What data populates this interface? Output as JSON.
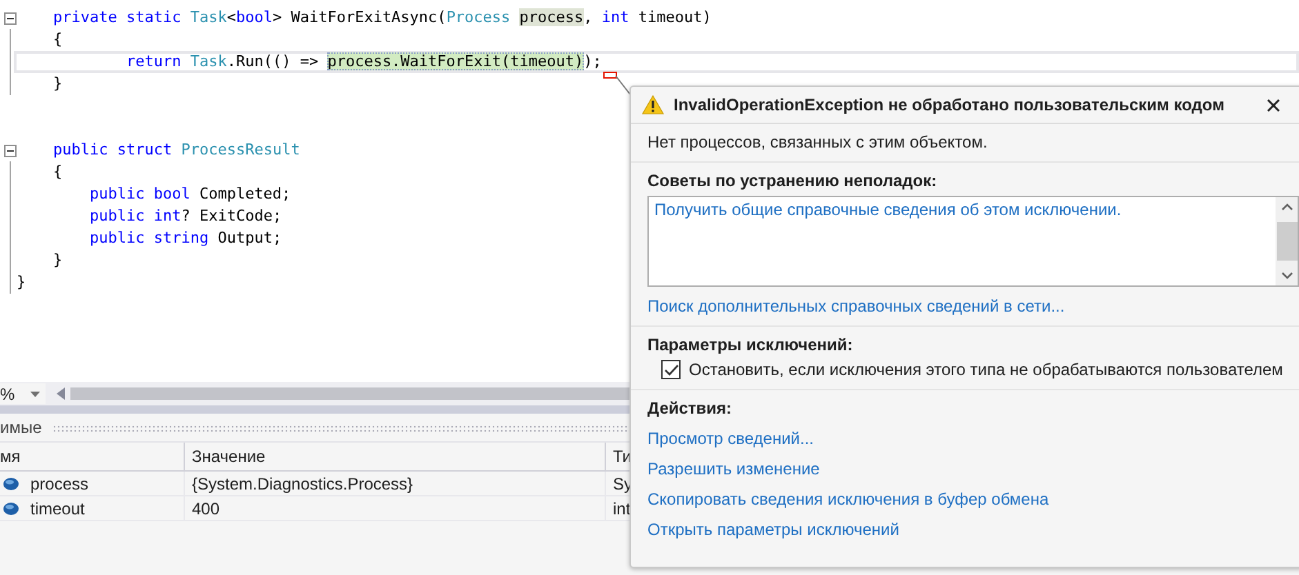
{
  "editor": {
    "lines": [
      {
        "fold": true,
        "current": false,
        "tokens": [
          {
            "text": "    private static ",
            "kind": "kw"
          },
          {
            "text": "Task",
            "kind": "type"
          },
          {
            "text": "<",
            "kind": "plain"
          },
          {
            "text": "bool",
            "kind": "kw"
          },
          {
            "text": "> WaitForExitAsync(",
            "kind": "plain"
          },
          {
            "text": "Process ",
            "kind": "type"
          },
          {
            "text": "process",
            "kind": "ref"
          },
          {
            "text": ", ",
            "kind": "plain"
          },
          {
            "text": "int",
            "kind": "kw"
          },
          {
            "text": " timeout)",
            "kind": "plain"
          }
        ]
      },
      {
        "fold": false,
        "current": false,
        "tokens": [
          {
            "text": "    {",
            "kind": "plain"
          }
        ]
      },
      {
        "fold": false,
        "current": true,
        "tokens": [
          {
            "text": "            return ",
            "kind": "kw"
          },
          {
            "text": "Task",
            "kind": "type"
          },
          {
            "text": ".Run(() => ",
            "kind": "plain"
          },
          {
            "text": "process.WaitForExit(timeout)",
            "kind": "exec"
          },
          {
            "text": ");",
            "kind": "plain"
          }
        ]
      },
      {
        "fold": false,
        "current": false,
        "tokens": [
          {
            "text": "    }",
            "kind": "plain"
          }
        ]
      },
      {
        "fold": false,
        "current": false
      },
      {
        "fold": false,
        "current": false
      },
      {
        "fold": true,
        "current": false,
        "tokens": [
          {
            "text": "    public struct ",
            "kind": "kw"
          },
          {
            "text": "ProcessResult",
            "kind": "type"
          }
        ]
      },
      {
        "fold": false,
        "current": false,
        "tokens": [
          {
            "text": "    {",
            "kind": "plain"
          }
        ]
      },
      {
        "fold": false,
        "current": false,
        "tokens": [
          {
            "text": "        public bool ",
            "kind": "kw"
          },
          {
            "text": "Completed;",
            "kind": "plain"
          }
        ]
      },
      {
        "fold": false,
        "current": false,
        "tokens": [
          {
            "text": "        public int",
            "kind": "kw"
          },
          {
            "text": "? ExitCode;",
            "kind": "plain"
          }
        ]
      },
      {
        "fold": false,
        "current": false,
        "tokens": [
          {
            "text": "        public string ",
            "kind": "kw"
          },
          {
            "text": "Output;",
            "kind": "plain"
          }
        ]
      },
      {
        "fold": false,
        "current": false,
        "tokens": [
          {
            "text": "    }",
            "kind": "plain"
          }
        ]
      },
      {
        "fold": false,
        "current": false,
        "tokens": [
          {
            "text": "}",
            "kind": "plain"
          }
        ]
      }
    ]
  },
  "zoom_combo": {
    "value": "%"
  },
  "locals": {
    "title": "имые",
    "columns": [
      "мя",
      "Значение",
      "Ти"
    ],
    "rows": [
      {
        "name": "process",
        "value": "{System.Diagnostics.Process}",
        "type": "Sy"
      },
      {
        "name": "timeout",
        "value": "400",
        "type": "int"
      }
    ]
  },
  "exception_popup": {
    "title": "InvalidOperationException не обработано пользовательским кодом",
    "message": "Нет процессов, связанных с этим объектом.",
    "tips_heading": "Советы по устранению неполадок:",
    "tips": [
      "Получить общие справочные сведения об этом исключении."
    ],
    "search_link": "Поиск дополнительных справочных сведений в сети...",
    "settings_heading": "Параметры исключений:",
    "break_option": {
      "label": "Остановить, если исключения этого типа не обрабатываются пользователем",
      "checked": true
    },
    "actions_heading": "Действия:",
    "actions": [
      "Просмотр сведений...",
      "Разрешить изменение",
      "Скопировать сведения исключения в буфер обмена",
      "Открыть параметры исключений"
    ]
  }
}
